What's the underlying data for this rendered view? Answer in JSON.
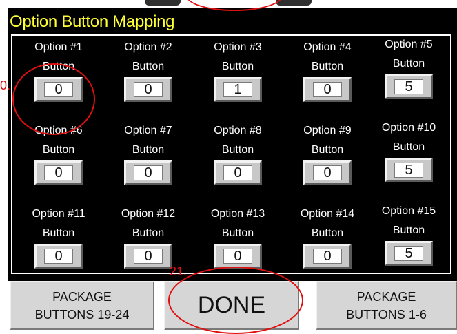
{
  "screen": {
    "title": "Option Button Mapping",
    "button_word": "Button",
    "cells": [
      {
        "label": "Option #1",
        "value": "0"
      },
      {
        "label": "Option #2",
        "value": "0"
      },
      {
        "label": "Option #3",
        "value": "1"
      },
      {
        "label": "Option #4",
        "value": "0"
      },
      {
        "label": "Option #5",
        "value": "5"
      },
      {
        "label": "Option #6",
        "value": "0"
      },
      {
        "label": "Option #7",
        "value": "0"
      },
      {
        "label": "Option #8",
        "value": "0"
      },
      {
        "label": "Option #9",
        "value": "0"
      },
      {
        "label": "Option #10",
        "value": "5"
      },
      {
        "label": "Option #11",
        "value": "0"
      },
      {
        "label": "Option #12",
        "value": "0"
      },
      {
        "label": "Option #13",
        "value": "0"
      },
      {
        "label": "Option #14",
        "value": "0"
      },
      {
        "label": "Option #15",
        "value": "5"
      }
    ]
  },
  "footer": {
    "left_button": {
      "line1": "PACKAGE",
      "line2": "BUTTONS 19-24"
    },
    "done_button": "DONE",
    "right_button": {
      "line1": "PACKAGE",
      "line2": "BUTTONS 1-6"
    }
  },
  "annotations": {
    "left_mark": "0.",
    "done_mark": "21."
  },
  "colors": {
    "title": "#ffff33",
    "screen_bg": "#000000",
    "annotation": "#e01010",
    "button_face": "#d6d6d6"
  }
}
